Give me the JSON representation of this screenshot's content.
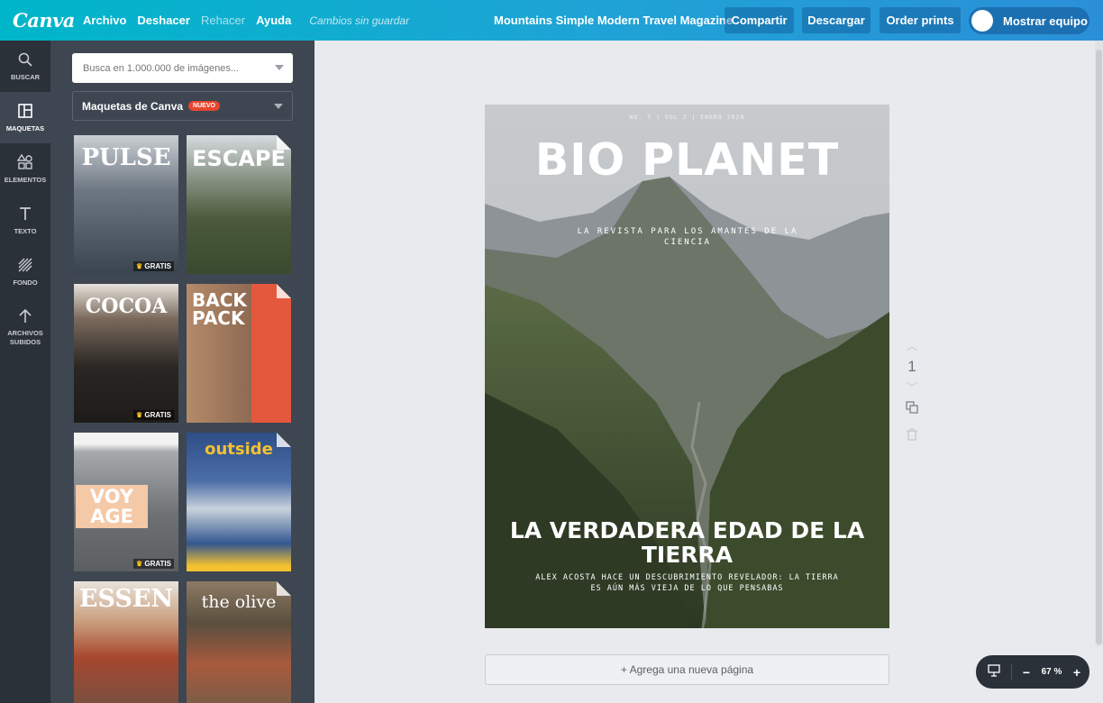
{
  "topbar": {
    "logo": "Canva",
    "menu": [
      "Archivo",
      "Deshacer",
      "Rehacer",
      "Ayuda"
    ],
    "unsaved": "Cambios sin guardar",
    "doc_title": "Mountains Simple Modern Travel Magazine",
    "share": "Compartir",
    "download": "Descargar",
    "print": "Order prints",
    "team": "Mostrar equipo"
  },
  "rail": [
    {
      "label": "BUSCAR",
      "icon": "search-icon"
    },
    {
      "label": "MAQUETAS",
      "icon": "layout-icon"
    },
    {
      "label": "ELEMENTOS",
      "icon": "shapes-icon"
    },
    {
      "label": "TEXTO",
      "icon": "text-icon"
    },
    {
      "label": "FONDO",
      "icon": "background-icon"
    },
    {
      "label": "ARCHIVOS SUBIDOS",
      "icon": "upload-icon"
    }
  ],
  "panel": {
    "search_placeholder": "Busca en 1.000.000 de imágenes...",
    "filter_label": "Maquetas de Canva",
    "filter_badge": "NUEVO",
    "templates": [
      {
        "title": "PULSE",
        "badge": "GRATIS",
        "color": "#4a5560"
      },
      {
        "title": "ESCAPE",
        "badge": "",
        "color": "#4b5a3c"
      },
      {
        "title": "COCOA",
        "badge": "GRATIS",
        "color": "#2a2623"
      },
      {
        "title": "BACK PACK",
        "badge": "",
        "color": "#e4583e"
      },
      {
        "title": "VOY AGE",
        "badge": "GRATIS",
        "color": "#8b8f92"
      },
      {
        "title": "outside",
        "badge": "",
        "color": "#2d4e86"
      },
      {
        "title": "ESSEN",
        "badge": "",
        "color": "#6b5346"
      },
      {
        "title": "the olive",
        "badge": "",
        "color": "#5a4f3e"
      }
    ]
  },
  "page": {
    "issue": "NO. 7  |  VOL 2  |  ENERO 2020",
    "title": "BIO PLANET",
    "tagline": "LA REVISTA PARA LOS AMANTES DE LA CIENCIA",
    "headline": "LA VERDADERA EDAD DE LA TIERRA",
    "subhead": "ALEX ACOSTA HACE UN DESCUBRIMIENTO REVELADOR: LA TIERRA ES AÚN MÁS VIEJA DE LO QUE PENSABAS"
  },
  "page_tools": {
    "page_number": "1"
  },
  "add_page": "+ Agrega una nueva página",
  "zoom": {
    "value": "67 %",
    "minus": "−",
    "plus": "+"
  }
}
